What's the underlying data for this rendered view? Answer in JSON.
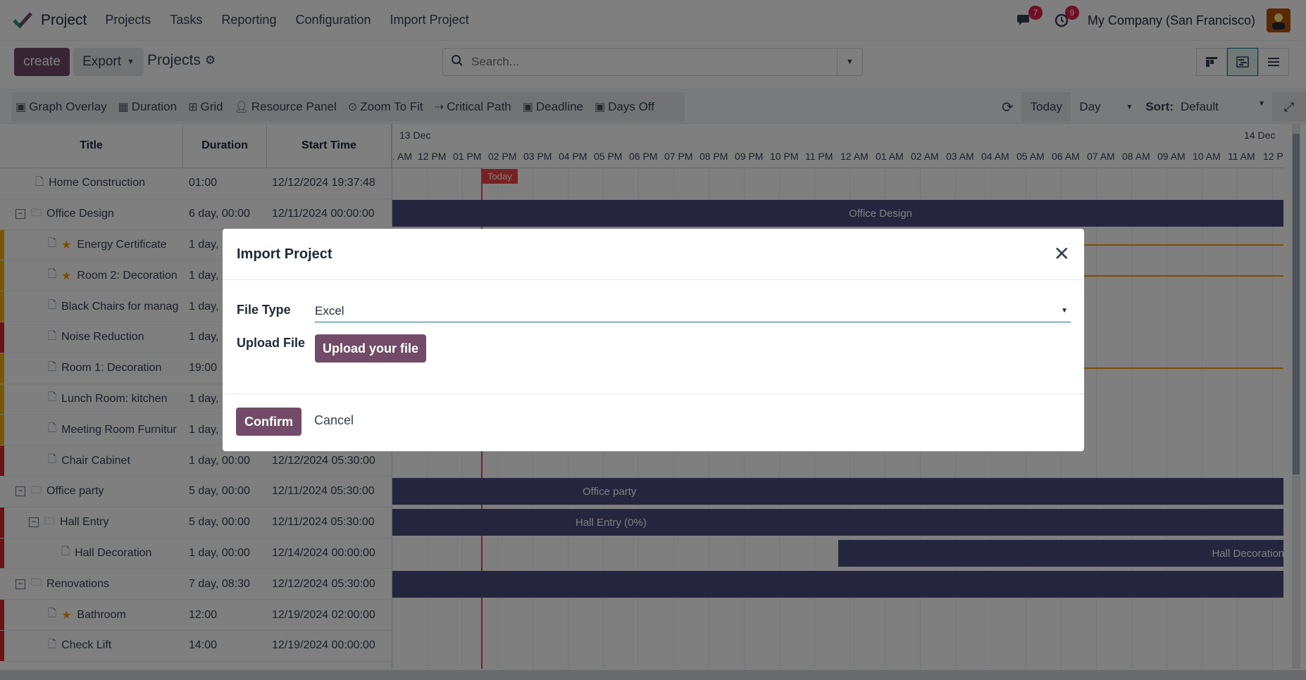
{
  "app": {
    "name": "Project"
  },
  "menu": [
    "Projects",
    "Tasks",
    "Reporting",
    "Configuration",
    "Import Project"
  ],
  "systray": {
    "messages_count": "7",
    "activities_count": "9",
    "company": "My Company (San Francisco)"
  },
  "control": {
    "create_label": "create",
    "export_label": "Export",
    "breadcrumb": "Projects",
    "search_placeholder": "Search..."
  },
  "gantt_toolbar": {
    "tools": [
      "Graph Overlay",
      "Duration",
      "Grid",
      "Resource Panel",
      "Zoom To Fit",
      "Critical Path",
      "Deadline",
      "Days Off"
    ],
    "today_label": "Today",
    "scale": "Day",
    "sort_label": "Sort:",
    "sort_value": "Default"
  },
  "grid": {
    "headers": {
      "title": "Title",
      "duration": "Duration",
      "start": "Start Time"
    },
    "rows": [
      {
        "title": "Home Construction",
        "duration": "01:00",
        "start": "12/12/2024 19:37:48"
      },
      {
        "title": "Office Design",
        "duration": "6 day, 00:00",
        "start": "12/11/2024 00:00:00"
      },
      {
        "title": "Energy Certificate",
        "duration": "1 day,",
        "start": ""
      },
      {
        "title": "Room 2: Decoration",
        "duration": "1 day,",
        "start": ""
      },
      {
        "title": "Black Chairs for manag",
        "duration": "1 day,",
        "start": ""
      },
      {
        "title": "Noise Reduction",
        "duration": "1 day,",
        "start": ""
      },
      {
        "title": "Room 1: Decoration",
        "duration": "19:00",
        "start": ""
      },
      {
        "title": "Lunch Room: kitchen",
        "duration": "1 day,",
        "start": ""
      },
      {
        "title": "Meeting Room Furnitur",
        "duration": "1 day,",
        "start": ""
      },
      {
        "title": "Chair Cabinet",
        "duration": "1 day, 00:00",
        "start": "12/12/2024 05:30:00"
      },
      {
        "title": "Office party",
        "duration": "5 day, 00:00",
        "start": "12/11/2024 05:30:00"
      },
      {
        "title": "Hall Entry",
        "duration": "5 day, 00:00",
        "start": "12/11/2024 05:30:00"
      },
      {
        "title": "Hall Decoration",
        "duration": "1 day, 00:00",
        "start": "12/14/2024 00:00:00"
      },
      {
        "title": "Renovations",
        "duration": "7 day, 08:30",
        "start": "12/12/2024 05:30:00"
      },
      {
        "title": "Bathroom",
        "duration": "12:00",
        "start": "12/19/2024 02:00:00"
      },
      {
        "title": "Check Lift",
        "duration": "14:00",
        "start": "12/19/2024 00:00:00"
      }
    ]
  },
  "timeline": {
    "date_left": "13 Dec",
    "date_right": "14 Dec",
    "hours": [
      ". AM",
      "12 PM",
      "01 PM",
      "02 PM",
      "03 PM",
      "04 PM",
      "05 PM",
      "06 PM",
      "07 PM",
      "08 PM",
      "09 PM",
      "10 PM",
      "11 PM",
      "12 AM",
      "01 AM",
      "02 AM",
      "03 AM",
      "04 AM",
      "05 AM",
      "06 AM",
      "07 AM",
      "08 AM",
      "09 AM",
      "10 AM",
      "11 AM",
      "12 P"
    ],
    "today_tag": "Today",
    "bars": {
      "office_design": "Office Design",
      "office_party": "Office party",
      "hall_entry": "Hall Entry (0%)",
      "hall_decoration": "Hall Decoration"
    }
  },
  "modal": {
    "title": "Import Project",
    "file_type_label": "File Type",
    "file_type_value": "Excel",
    "upload_label": "Upload File",
    "upload_button": "Upload your file",
    "confirm": "Confirm",
    "cancel": "Cancel"
  },
  "colors": {
    "primary": "#714b67",
    "bar": "#4b4a7a",
    "today": "#ef4444",
    "priority_red": "#dc2626",
    "priority_yellow": "#eab308"
  }
}
